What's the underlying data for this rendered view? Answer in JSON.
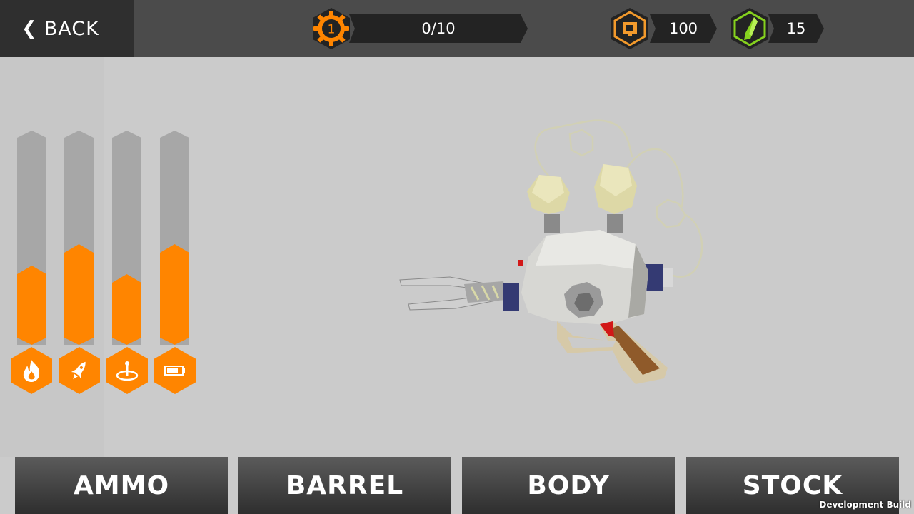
{
  "topbar": {
    "back_label": "BACK",
    "gear": {
      "level": "1",
      "progress": "0/10",
      "icon": "gear-icon",
      "color": "#ff8500"
    },
    "coins": {
      "value": "100",
      "icon": "coin-icon",
      "color": "#f39a2c"
    },
    "gems": {
      "value": "15",
      "icon": "gem-icon",
      "color": "#86d21e"
    }
  },
  "stats": [
    {
      "name": "fire-damage",
      "icon": "fire-icon",
      "level": 0.37
    },
    {
      "name": "rocket-speed",
      "icon": "rocket-icon",
      "level": 0.47
    },
    {
      "name": "area-range",
      "icon": "target-icon",
      "level": 0.33
    },
    {
      "name": "battery-capacity",
      "icon": "battery-icon",
      "level": 0.47
    }
  ],
  "tabs": [
    "AMMO",
    "BARREL",
    "BODY",
    "STOCK"
  ],
  "dev_label": "Development Build",
  "colors": {
    "accent": "#ff8500",
    "topbar": "#4b4b4b",
    "background": "#cbcbcb"
  }
}
